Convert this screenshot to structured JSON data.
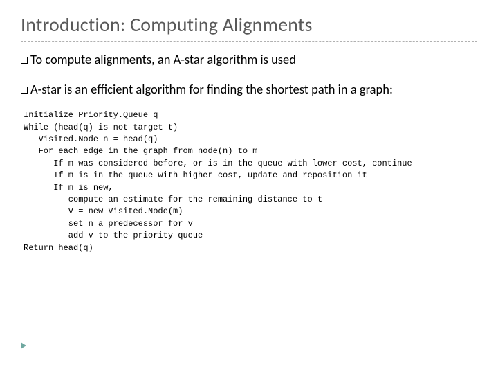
{
  "title": "Introduction: Computing Alignments",
  "bullet1_prefix": "To",
  "bullet1_rest": " compute alignments, an A-star algorithm is used",
  "bullet2_prefix": "A-star",
  "bullet2_rest": " is an efficient algorithm for finding the shortest path in a graph:",
  "code": "Initialize Priority.Queue q\nWhile (head(q) is not target t)\n   Visited.Node n = head(q)\n   For each edge in the graph from node(n) to m\n      If m was considered before, or is in the queue with lower cost, continue\n      If m is in the queue with higher cost, update and reposition it\n      If m is new,\n         compute an estimate for the remaining distance to t\n         V = new Visited.Node(m)\n         set n a predecessor for v\n         add v to the priority queue\nReturn head(q)"
}
